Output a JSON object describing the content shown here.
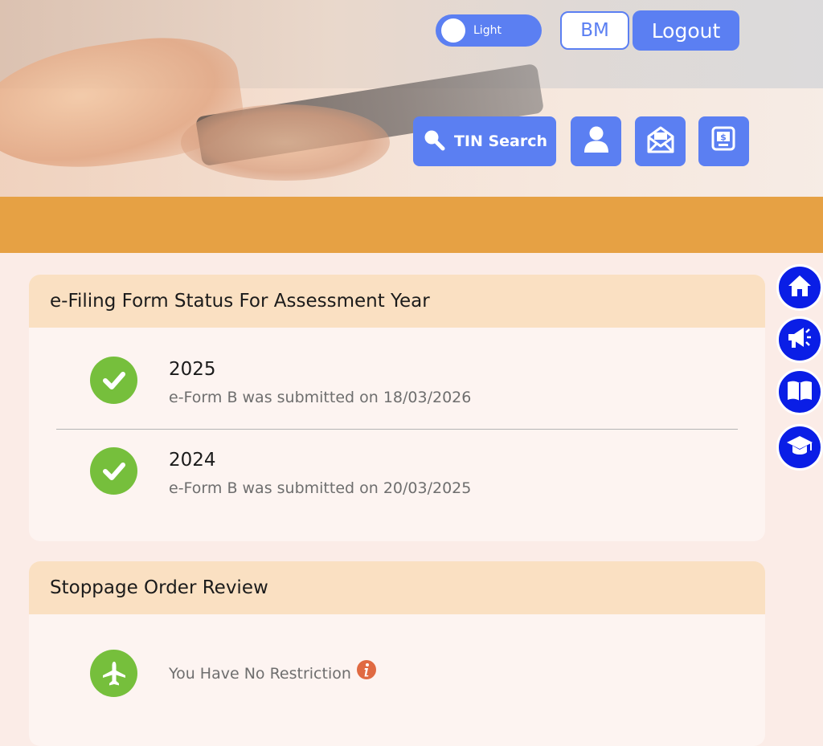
{
  "header": {
    "theme_toggle": {
      "label": "Light",
      "state": "light"
    },
    "language_button": "BM",
    "logout_button": "Logout",
    "tin_search_button": "TIN Search",
    "icon_buttons": [
      "user-icon",
      "mail-icon",
      "payment-icon"
    ]
  },
  "side_nav": [
    "home-icon",
    "announcement-icon",
    "book-icon",
    "graduation-cap-icon"
  ],
  "efiling_card": {
    "title": "e-Filing Form Status For Assessment Year",
    "items": [
      {
        "year": "2025",
        "message": "e-Form B was submitted on 18/03/2026"
      },
      {
        "year": "2024",
        "message": "e-Form B was submitted on 20/03/2025"
      }
    ]
  },
  "stoppage_card": {
    "title": "Stoppage Order Review",
    "status_text": "You Have No Restriction"
  },
  "colors": {
    "primary_button": "#5b7ff2",
    "accent_bar": "#e6a144",
    "side_nav_button": "#0a1ee6",
    "success": "#76bf3c",
    "info": "#e06a42",
    "card_header": "#fae0c2",
    "page_background": "#fbece7"
  }
}
